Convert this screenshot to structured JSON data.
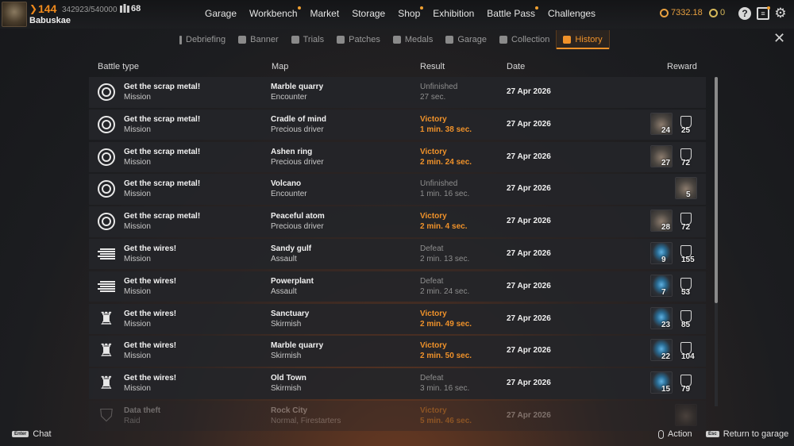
{
  "player": {
    "level": "144",
    "xp": "342923/540000",
    "badge_value": "68",
    "name": "Babuskae"
  },
  "main_nav": [
    {
      "label": "Garage",
      "dot": false
    },
    {
      "label": "Workbench",
      "dot": true
    },
    {
      "label": "Market",
      "dot": false
    },
    {
      "label": "Storage",
      "dot": false
    },
    {
      "label": "Shop",
      "dot": true
    },
    {
      "label": "Exhibition",
      "dot": false
    },
    {
      "label": "Battle Pass",
      "dot": true
    },
    {
      "label": "Challenges",
      "dot": false
    }
  ],
  "currency": {
    "coins": "7332.18",
    "badges": "0"
  },
  "sub_nav": [
    {
      "label": "Debriefing",
      "icon": "info-icon"
    },
    {
      "label": "Banner",
      "icon": "banner-icon"
    },
    {
      "label": "Trials",
      "icon": "trials-icon"
    },
    {
      "label": "Patches",
      "icon": "patches-icon"
    },
    {
      "label": "Medals",
      "icon": "medal-icon"
    },
    {
      "label": "Garage",
      "icon": "garage-icon"
    },
    {
      "label": "Collection",
      "icon": "collection-icon"
    },
    {
      "label": "History",
      "icon": "history-icon",
      "active": true
    }
  ],
  "columns": {
    "battle_type": "Battle type",
    "map": "Map",
    "result": "Result",
    "date": "Date",
    "reward": "Reward"
  },
  "rows": [
    {
      "icon": "hex-icon",
      "type": "Get the scrap metal!",
      "mode": "Mission",
      "map": "Marble quarry",
      "map_mode": "Encounter",
      "result": "Unfinished",
      "duration": "27 sec.",
      "status": "grey",
      "date": "27 Apr 2026",
      "rewards": []
    },
    {
      "icon": "hex-icon",
      "type": "Get the scrap metal!",
      "mode": "Mission",
      "map": "Cradle of mind",
      "map_mode": "Precious driver",
      "result": "Victory",
      "duration": "1 min. 38 sec.",
      "status": "victory",
      "date": "27 Apr 2026",
      "rewards": [
        {
          "kind": "scrap",
          "amount": "24"
        },
        {
          "kind": "badge",
          "amount": "25"
        }
      ]
    },
    {
      "icon": "hex-icon",
      "type": "Get the scrap metal!",
      "mode": "Mission",
      "map": "Ashen ring",
      "map_mode": "Precious driver",
      "result": "Victory",
      "duration": "2 min. 24 sec.",
      "status": "victory",
      "date": "27 Apr 2026",
      "rewards": [
        {
          "kind": "scrap",
          "amount": "27"
        },
        {
          "kind": "badge",
          "amount": "72"
        }
      ]
    },
    {
      "icon": "hex-icon",
      "type": "Get the scrap metal!",
      "mode": "Mission",
      "map": "Volcano",
      "map_mode": "Encounter",
      "result": "Unfinished",
      "duration": "1 min. 16 sec.",
      "status": "grey",
      "date": "27 Apr 2026",
      "rewards": [
        {
          "kind": "scrap",
          "amount": "5"
        }
      ]
    },
    {
      "icon": "hex-icon",
      "type": "Get the scrap metal!",
      "mode": "Mission",
      "map": "Peaceful atom",
      "map_mode": "Precious driver",
      "result": "Victory",
      "duration": "2 min. 4 sec.",
      "status": "victory",
      "date": "27 Apr 2026",
      "rewards": [
        {
          "kind": "scrap",
          "amount": "28"
        },
        {
          "kind": "badge",
          "amount": "72"
        }
      ]
    },
    {
      "icon": "lines-icon",
      "type": "Get the wires!",
      "mode": "Mission",
      "map": "Sandy gulf",
      "map_mode": "Assault",
      "result": "Defeat",
      "duration": "2 min. 13 sec.",
      "status": "grey",
      "date": "27 Apr 2026",
      "rewards": [
        {
          "kind": "wire",
          "amount": "9"
        },
        {
          "kind": "badge",
          "amount": "155"
        }
      ]
    },
    {
      "icon": "lines-icon",
      "type": "Get the wires!",
      "mode": "Mission",
      "map": "Powerplant",
      "map_mode": "Assault",
      "result": "Defeat",
      "duration": "2 min. 24 sec.",
      "status": "grey",
      "date": "27 Apr 2026",
      "rewards": [
        {
          "kind": "wire",
          "amount": "7"
        },
        {
          "kind": "badge",
          "amount": "53"
        }
      ]
    },
    {
      "icon": "mech-icon",
      "type": "Get the wires!",
      "mode": "Mission",
      "map": "Sanctuary",
      "map_mode": "Skirmish",
      "result": "Victory",
      "duration": "2 min. 49 sec.",
      "status": "victory",
      "date": "27 Apr 2026",
      "rewards": [
        {
          "kind": "wire",
          "amount": "23"
        },
        {
          "kind": "badge",
          "amount": "85"
        }
      ]
    },
    {
      "icon": "mech-icon",
      "type": "Get the wires!",
      "mode": "Mission",
      "map": "Marble quarry",
      "map_mode": "Skirmish",
      "result": "Victory",
      "duration": "2 min. 50 sec.",
      "status": "victory",
      "date": "27 Apr 2026",
      "rewards": [
        {
          "kind": "wire",
          "amount": "22"
        },
        {
          "kind": "badge",
          "amount": "104"
        }
      ]
    },
    {
      "icon": "mech-icon",
      "type": "Get the wires!",
      "mode": "Mission",
      "map": "Old Town",
      "map_mode": "Skirmish",
      "result": "Defeat",
      "duration": "3 min. 16 sec.",
      "status": "grey",
      "date": "27 Apr 2026",
      "rewards": [
        {
          "kind": "wire",
          "amount": "15"
        },
        {
          "kind": "badge",
          "amount": "79"
        }
      ]
    },
    {
      "icon": "shield-icon",
      "type": "Data theft",
      "mode": "Raid",
      "map": "Rock City",
      "map_mode": "Normal, Firestarters",
      "result": "Victory",
      "duration": "5 min. 46 sec.",
      "status": "victory",
      "date": "27 Apr 2026",
      "rewards": [
        {
          "kind": "scrap",
          "amount": ""
        }
      ],
      "faded": true
    }
  ],
  "footer": {
    "chat_key": "Enter",
    "chat_label": "Chat",
    "action_label": "Action",
    "return_key": "Esc",
    "return_label": "Return to garage"
  },
  "colors": {
    "accent": "#f0922a",
    "victory": "#f0922a",
    "muted": "#8e8e8e",
    "row_bg": "#242529"
  }
}
